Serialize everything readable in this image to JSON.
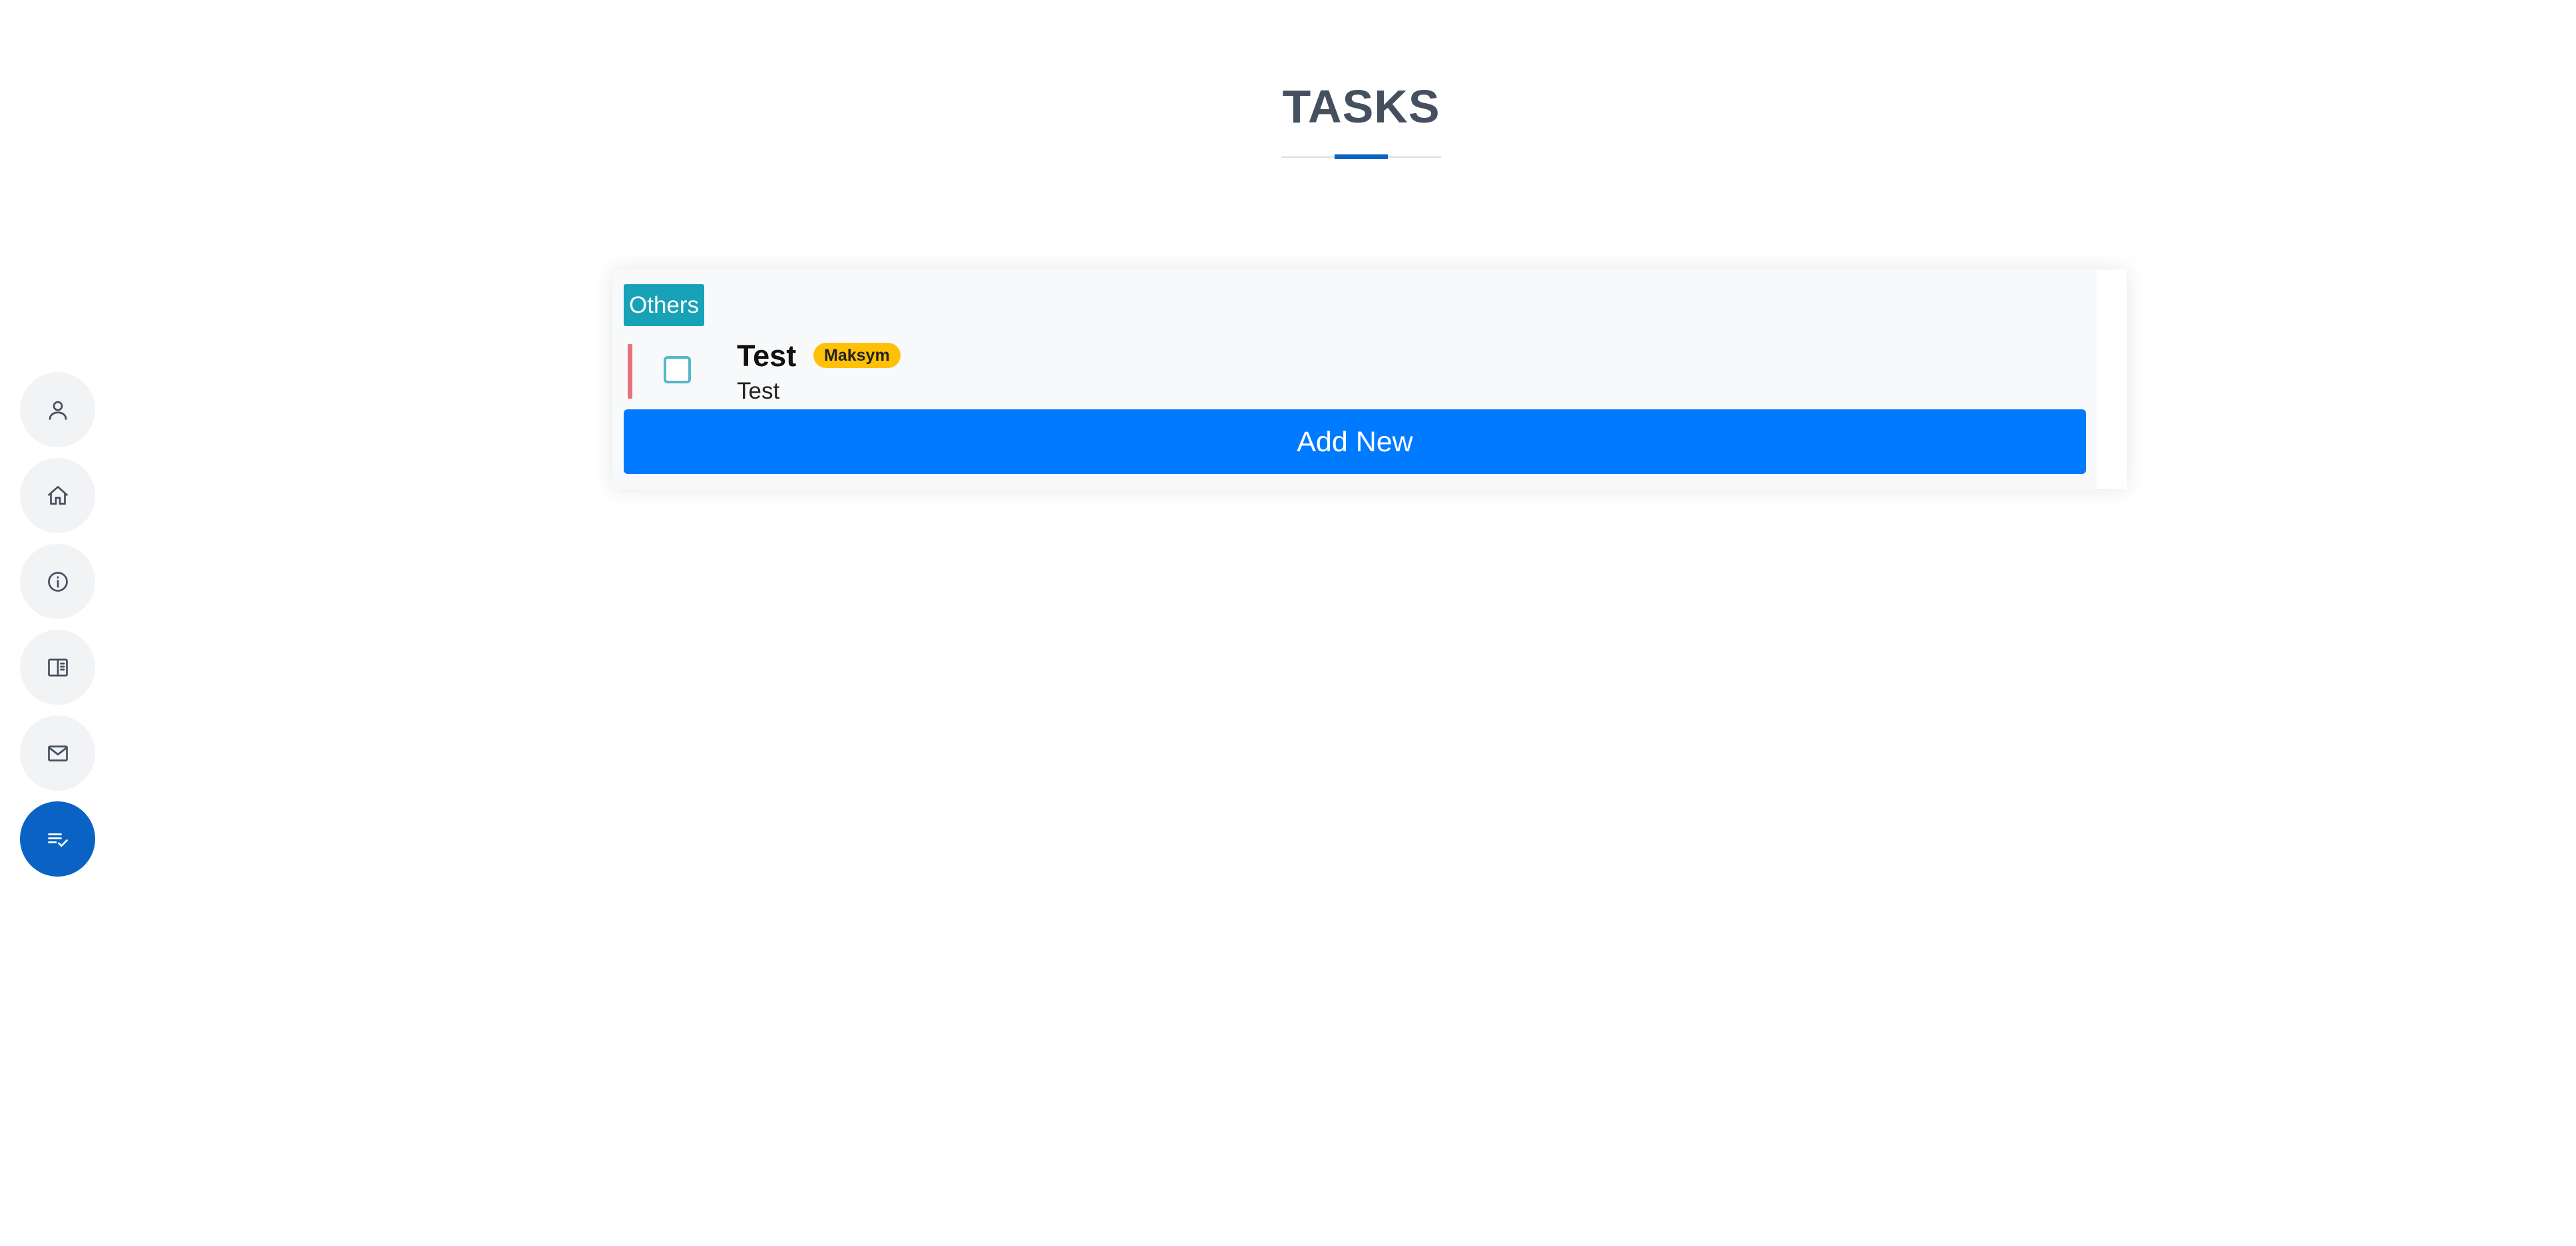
{
  "header": {
    "title": "TASKS"
  },
  "side_nav": {
    "items": [
      {
        "icon": "person-icon",
        "active": false
      },
      {
        "icon": "home-icon",
        "active": false
      },
      {
        "icon": "info-icon",
        "active": false
      },
      {
        "icon": "book-icon",
        "active": false
      },
      {
        "icon": "envelope-icon",
        "active": false
      },
      {
        "icon": "task-list-icon",
        "active": true
      }
    ]
  },
  "task_list": {
    "category": "Others",
    "tasks": [
      {
        "title": "Test",
        "assignee": "Maksym",
        "description": "Test",
        "completed": false
      }
    ],
    "add_button_label": "Add New"
  },
  "colors": {
    "accent": "#0a63c4",
    "primary_button": "#007bff",
    "category_badge": "#17a2b8",
    "assignee_badge": "#ffc107",
    "priority_bar": "#e8717d"
  }
}
